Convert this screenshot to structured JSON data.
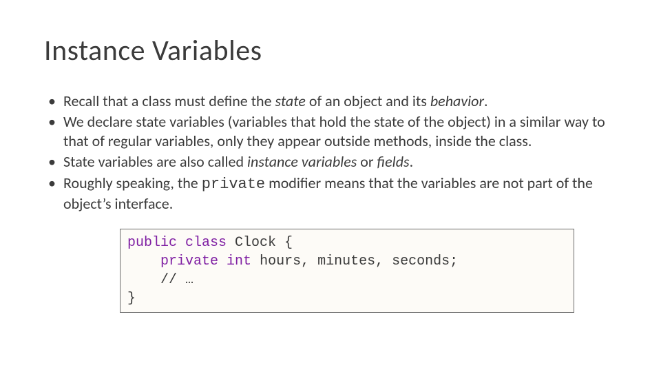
{
  "title": "Instance Variables",
  "bullets": {
    "b1": {
      "pre": "Recall that a class must define the ",
      "state": "state",
      "mid": " of an object and its ",
      "behavior": "behavior",
      "post": "."
    },
    "b2": "We declare state variables (variables that hold the state of the object) in a similar way to that of regular variables, only they appear outside methods, inside the class.",
    "b3": {
      "pre": "State variables are also called ",
      "iv": "instance variables",
      "mid": " or ",
      "fields": "fields",
      "post": "."
    },
    "b4": {
      "pre": "Roughly speaking, the ",
      "priv": "private",
      "post": " modifier means that the variables are not part of the object’s interface."
    }
  },
  "code": {
    "kw_public": "public",
    "kw_class": "class",
    "cls_name": " Clock {",
    "indent": "    ",
    "kw_private": "private",
    "kw_int": "int",
    "vars": " hours, minutes, seconds;",
    "comment": "// …",
    "close": "}"
  }
}
